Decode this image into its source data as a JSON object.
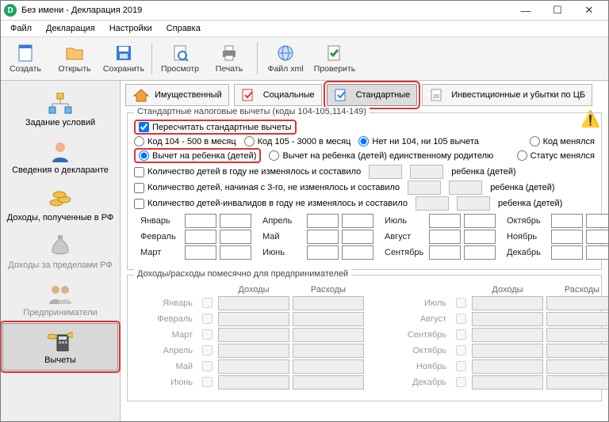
{
  "title": "Без имени - Декларация 2019",
  "menu": {
    "file": "Файл",
    "decl": "Декларация",
    "settings": "Настройки",
    "help": "Справка"
  },
  "toolbar": {
    "create": "Создать",
    "open": "Открыть",
    "save": "Сохранить",
    "preview": "Просмотр",
    "print": "Печать",
    "xml": "Файл xml",
    "check": "Проверить"
  },
  "sidebar": {
    "s0": "Задание условий",
    "s1": "Сведения о декларанте",
    "s2": "Доходы, полученные в РФ",
    "s3": "Доходы за пределами РФ",
    "s4": "Предприниматели",
    "s5": "Вычеты"
  },
  "tabs": {
    "prop": "Имущественный",
    "soc": "Социальные",
    "std": "Стандартные",
    "inv": "Инвестиционные и убытки по ЦБ"
  },
  "group_caption": "Стандартные налоговые вычеты (коды 104-105,114-149)",
  "recalc": "Пересчитать стандартные вычеты",
  "r1": {
    "o1": "Код 104 - 500 в месяц",
    "o2": "Код 105 - 3000 в месяц",
    "o3": "Нет ни 104, ни 105 вычета",
    "o4": "Код менялся"
  },
  "r2": {
    "o1": "Вычет на ребенка (детей)",
    "o2": "Вычет на ребенка (детей) единственному родителю",
    "o3": "Статус менялся"
  },
  "kids": {
    "k1": "Количество детей в году не изменялось и составило",
    "k2": "Количество детей, начиная с 3-го, не изменялось и составило",
    "k3": "Количество детей-инвалидов в году не изменялось и составило",
    "suffix": "ребенка (детей)"
  },
  "months": {
    "m1": "Январь",
    "m2": "Февраль",
    "m3": "Март",
    "m4": "Апрель",
    "m5": "Май",
    "m6": "Июнь",
    "m7": "Июль",
    "m8": "Август",
    "m9": "Сентябрь",
    "m10": "Октябрь",
    "m11": "Ноябрь",
    "m12": "Декабрь"
  },
  "ent_caption": "Доходы/расходы помесячно для предпринимателей",
  "ent_hdr": {
    "inc": "Доходы",
    "exp": "Расходы"
  }
}
